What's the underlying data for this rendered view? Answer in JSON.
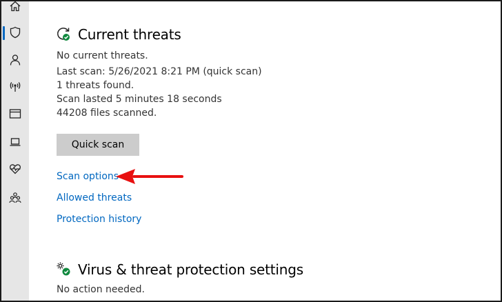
{
  "sidebar": {
    "items": [
      {
        "icon": "home-icon"
      },
      {
        "icon": "shield-icon",
        "active": true
      },
      {
        "icon": "person-icon"
      },
      {
        "icon": "wifi-antenna-icon"
      },
      {
        "icon": "app-browser-icon"
      },
      {
        "icon": "laptop-icon"
      },
      {
        "icon": "heart-pulse-icon"
      },
      {
        "icon": "family-icon"
      }
    ]
  },
  "current_threats": {
    "title": "Current threats",
    "icon": "scan-refresh-check-icon",
    "status": "No current threats.",
    "last_scan": "Last scan: 5/26/2021 8:21 PM (quick scan)",
    "threats_found": "1 threats found.",
    "scan_duration": "Scan lasted 5 minutes 18 seconds",
    "files_scanned": "44208 files scanned.",
    "quick_scan_label": "Quick scan",
    "links": {
      "scan_options": "Scan options",
      "allowed_threats": "Allowed threats",
      "protection_history": "Protection history"
    }
  },
  "annotation": {
    "arrow_color": "#e81010",
    "points_to": "Scan options"
  },
  "virus_settings": {
    "title": "Virus & threat protection settings",
    "icon": "settings-gear-check-icon",
    "status": "No action needed."
  },
  "colors": {
    "link": "#0067c0",
    "sidebar_bg": "#e6e6e6",
    "button_bg": "#cccccc",
    "check_green": "#10893e"
  }
}
